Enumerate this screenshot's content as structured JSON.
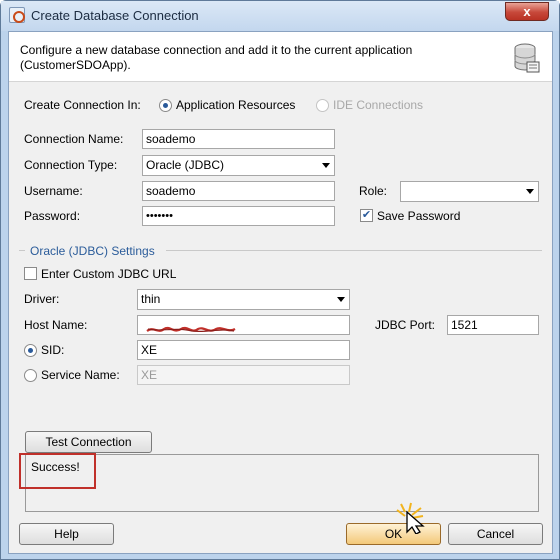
{
  "window": {
    "title": "Create Database Connection",
    "close_label": "x"
  },
  "header": {
    "description": "Configure a new database connection and add it to the current application (CustomerSDOApp)."
  },
  "create_in": {
    "label": "Create Connection In:",
    "option_app": "Application Resources",
    "option_ide": "IDE Connections",
    "selected": "Application Resources"
  },
  "fields": {
    "connection_name_label": "Connection Name:",
    "connection_name_value": "soademo",
    "connection_type_label": "Connection Type:",
    "connection_type_value": "Oracle (JDBC)",
    "username_label": "Username:",
    "username_value": "soademo",
    "password_label": "Password:",
    "password_value": "•••••••",
    "role_label": "Role:",
    "role_value": "",
    "save_password_label": "Save Password",
    "save_password_checked": true
  },
  "jdbc": {
    "section_title": "Oracle (JDBC) Settings",
    "custom_url_label": "Enter Custom JDBC URL",
    "custom_url_checked": false,
    "driver_label": "Driver:",
    "driver_value": "thin",
    "host_label": "Host Name:",
    "host_value": "",
    "port_label": "JDBC Port:",
    "port_value": "1521",
    "sid_label": "SID:",
    "sid_value": "XE",
    "service_label": "Service Name:",
    "service_value": "XE",
    "sid_selected": true
  },
  "test": {
    "button_label": "Test Connection",
    "result": "Success!"
  },
  "footer": {
    "help_label": "Help",
    "ok_label": "OK",
    "cancel_label": "Cancel"
  },
  "colors": {
    "titlebar": "#c3d7ee",
    "accent": "#2b5c9a",
    "highlight": "#c0302a",
    "close": "#c7483a"
  },
  "icons": {
    "app": "app-icon",
    "database": "database-icon",
    "close": "close-icon",
    "cursor": "mouse-cursor-icon"
  }
}
